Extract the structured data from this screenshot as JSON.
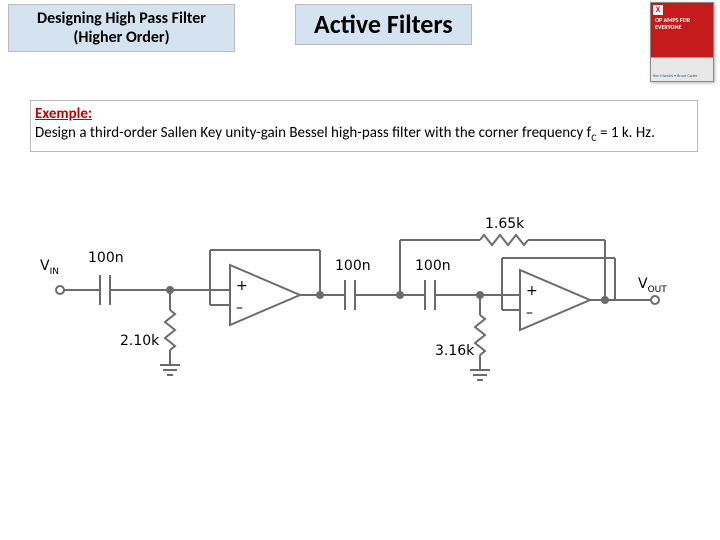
{
  "header": {
    "left_heading_line1": "Designing High Pass Filter",
    "left_heading_line2": "(Higher Order)",
    "main_title": "Active Filters"
  },
  "book": {
    "logo": "X",
    "title": "OP AMPS FOR EVERYONE",
    "bottom": "Ron Mancini • Bruce Carter"
  },
  "example": {
    "label": "Exemple:",
    "text_before_fc": "Design a third-order Sallen Key unity-gain Bessel high-pass filter with the corner frequency f",
    "fc_sub": "C",
    "text_after_fc": " = 1 k. Hz."
  },
  "circuit": {
    "vin": "V",
    "vin_sub": "IN",
    "vout": "V",
    "vout_sub": "OUT",
    "c1": "100n",
    "r1": "2.10k",
    "c2": "100n",
    "c3": "100n",
    "r2": "1.65k",
    "r3": "3.16k",
    "op_plus": "+",
    "op_minus": "–"
  }
}
